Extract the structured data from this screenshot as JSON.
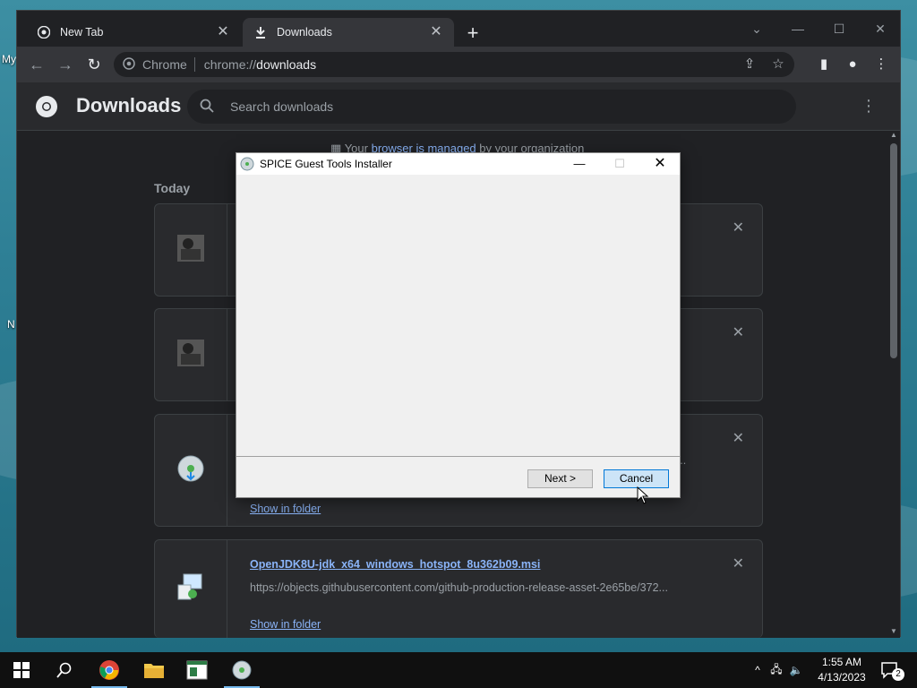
{
  "desktop": {
    "label_1": "My",
    "label_2": "N"
  },
  "browser": {
    "tabs": [
      {
        "label": "New Tab"
      },
      {
        "label": "Downloads"
      }
    ],
    "address": {
      "site_label": "Chrome",
      "scheme": "chrome://",
      "path": "downloads"
    }
  },
  "downloads_page": {
    "title": "Downloads",
    "search_placeholder": "Search downloads",
    "managed_text_1": "Your",
    "managed_link": "browser is managed",
    "managed_text_2": "by your organization",
    "section_today": "Today",
    "items": [
      {
        "name": "",
        "url": "",
        "show": ""
      },
      {
        "name": "",
        "url": "",
        "show": ""
      },
      {
        "name": "",
        "url": "l...",
        "show": "Show in folder"
      },
      {
        "name": "OpenJDK8U-jdk_x64_windows_hotspot_8u362b09.msi",
        "url": "https://objects.githubusercontent.com/github-production-release-asset-2e65be/372...",
        "show": "Show in folder"
      }
    ]
  },
  "dialog": {
    "title": "SPICE Guest Tools Installer",
    "next_label": "Next >",
    "cancel_label": "Cancel"
  },
  "taskbar": {
    "time": "1:55 AM",
    "date": "4/13/2023",
    "notification_count": "2"
  },
  "colors": {
    "accent": "#8ab4f8",
    "chrome_bg": "#202124",
    "dialog_primary": "#0078d7"
  }
}
